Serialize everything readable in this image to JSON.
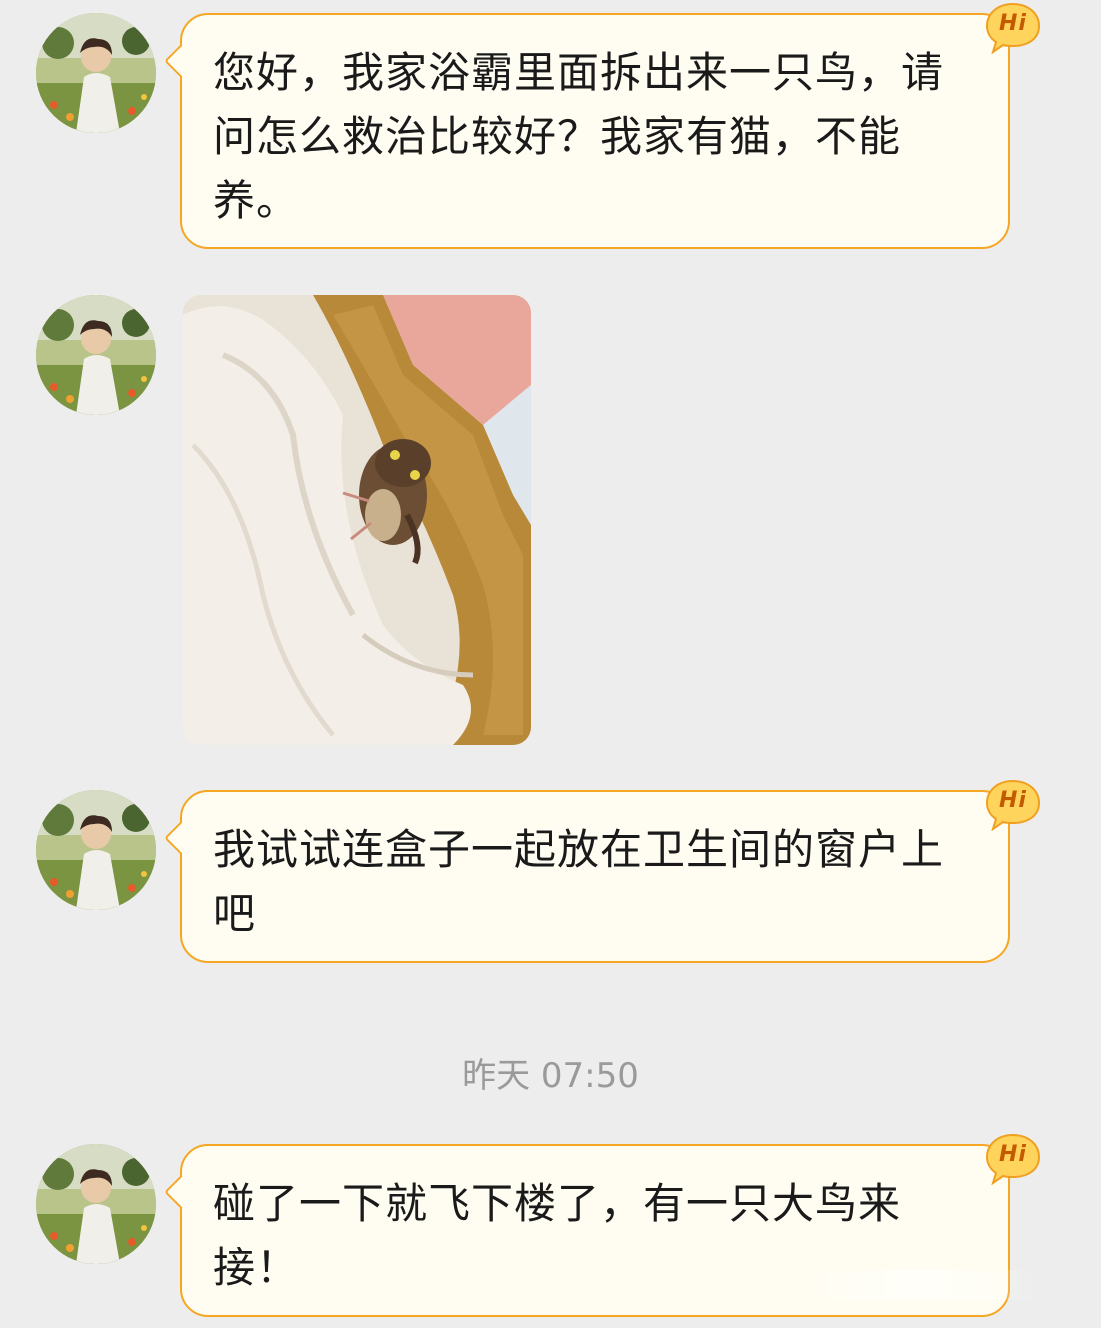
{
  "messages": [
    {
      "type": "text",
      "text": "您好，我家浴霸里面拆出来一只鸟，请问怎么救治比较好？我家有猫，不能养。",
      "badge": "Hi"
    },
    {
      "type": "image",
      "image_desc": "bird-on-towel-photo"
    },
    {
      "type": "text",
      "text": "我试试连盒子一起放在卫生间的窗户上吧",
      "badge": "Hi"
    },
    {
      "type": "text",
      "text": "碰了一下就飞下楼了，有一只大鸟来接！",
      "badge": "Hi"
    }
  ],
  "timestamp": "昨天 07:50",
  "colors": {
    "background": "#ededed",
    "bubble_fill": "#fffdf2",
    "bubble_border": "#f5a623",
    "badge_fill": "#ffd45c",
    "timestamp_text": "#9a9a9a"
  }
}
